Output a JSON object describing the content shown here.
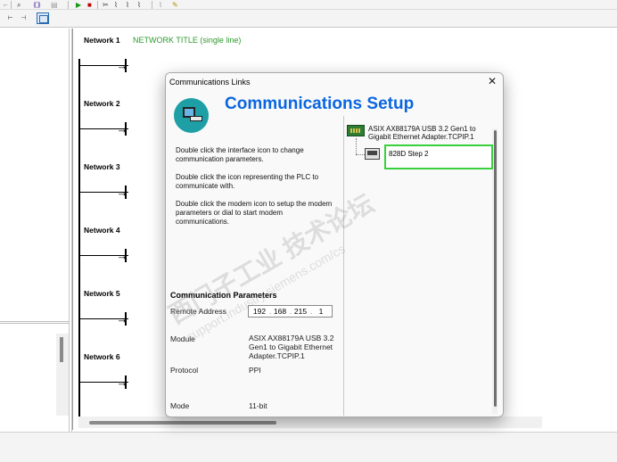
{
  "editor": {
    "network_title": "NETWORK TITLE (single line)",
    "networks": [
      "Network 1",
      "Network 2",
      "Network 3",
      "Network 4",
      "Network 5",
      "Network 6"
    ]
  },
  "dialog": {
    "title": "Communications Links",
    "close_glyph": "✕",
    "heading": "Communications Setup",
    "help_texts": [
      "Double click the interface icon to change communication parameters.",
      "Double click the icon representing the PLC to communicate with.",
      "Double click the modem icon to setup the modem parameters or dial to start modem communications."
    ],
    "params": {
      "title": "Communication Parameters",
      "remote_address_label": "Remote Address",
      "remote_address": [
        "192",
        "168",
        "215",
        "1"
      ],
      "module_label": "Module",
      "module_value": "ASIX AX88179A USB 3.2 Gen1 to Gigabit Ethernet Adapter.TCPIP.1",
      "protocol_label": "Protocol",
      "protocol_value": "PPI",
      "mode_label": "Mode",
      "mode_value": "11-bit"
    },
    "tree": {
      "adapter": "ASIX AX88179A USB 3.2 Gen1 to Gigabit Ethernet Adapter.TCPIP.1",
      "plc": "828D Step 2"
    }
  },
  "watermark": {
    "line1": "西门子工业 技术论坛",
    "line2": "support.industry.siemens.com/cs"
  },
  "icons": {
    "toolbar": [
      "find-icon",
      "run-icon",
      "stop-icon",
      "grid-view-icon"
    ],
    "adapter": "network-card-icon",
    "plc": "plc-icon"
  },
  "colors": {
    "accent": "#0a66e0",
    "network_title": "#2e9a2e",
    "selection": "#38d03c"
  }
}
